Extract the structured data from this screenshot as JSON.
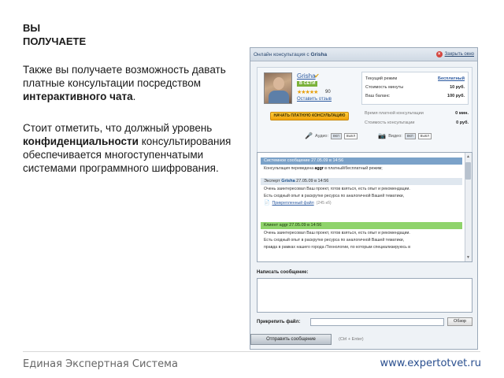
{
  "slide": {
    "heading_line1": "ВЫ",
    "heading_line2": "ПОЛУЧАЕТЕ",
    "p1_text1": "Также вы получаете возможность давать платные консультации посредством ",
    "p1_bold": "интерактивного чата",
    "p1_text2": ".",
    "p2_text1": "Стоит отметить, что должный уровень ",
    "p2_bold": "конфиденциальности",
    "p2_text2": " консультирования обеспечивается многоступенчатыми системами программного шифрования.",
    "footer_left": "Единая Экспертная Система",
    "footer_right": "www.expertotvet.ru"
  },
  "widget": {
    "title_prefix": "Онлайн консультация с ",
    "title_name": "Grisha",
    "close_label": "Закрыть окно",
    "profile": {
      "name": "Grisha",
      "status_badge": "В СЕТИ",
      "stars": "★★★★★",
      "rating_count": "90",
      "review_link": "Оставить отзыв",
      "paid_button": "НАЧАТЬ ПЛАТНУЮ КОНСУЛЬТАЦИЮ"
    },
    "stats": [
      {
        "label": "Текущий режим",
        "value": "Бесплатный"
      },
      {
        "label": "Стоимость минуты",
        "value": "10 руб."
      },
      {
        "label": "Ваш баланс",
        "value": "100 руб."
      }
    ],
    "stats2": [
      {
        "label": "Время платной консультации",
        "value": "0 мин."
      },
      {
        "label": "Стоимость консультации",
        "value": "0 руб."
      }
    ],
    "audio": {
      "label": "Аудио:",
      "on": "вкл",
      "off": "выкл"
    },
    "video": {
      "label": "Видео:",
      "on": "вкл",
      "off": "выкл"
    },
    "messages": {
      "system_head": "Системное сообщение   27.05.09 в 14:56",
      "system_body_pre": "Консультация переведена ",
      "system_body_user": "aggr",
      "system_body_post": " в платный/бесплатный режим;",
      "expert_head_label": "Эксперт ",
      "expert_head_name": "Grisha",
      "expert_head_time": "  27.05.09 в 14:56",
      "expert_body1": "Очень заинтересовал Ваш проект, готов взяться, есть опыт и рекомендации.",
      "expert_body2": "Есть сходный опыт в раскрутке ресурса по аналогичной Вашей тематики,",
      "attach_name": "Прикрепленный файл",
      "attach_size": "(245 кб)",
      "client_head": "Клиент aggr   27.05.09 в 14:56",
      "client_body1": "Очень заинтересовал Ваш проект, готов взяться, есть опыт и рекомендации.",
      "client_body2": "Есть сходный опыт в раскрутке ресурса по аналогичной Вашей тематики,",
      "client_body3": "правда в рамках нашего города /Технологии, по которым специализируюсь в"
    },
    "write_label": "Написать сообщение:",
    "attach_label": "Прикрепить файл:",
    "browse_button": "Обзор",
    "send_button": "Отправить сообщение",
    "send_hint": "(Ctrl + Enter)"
  }
}
